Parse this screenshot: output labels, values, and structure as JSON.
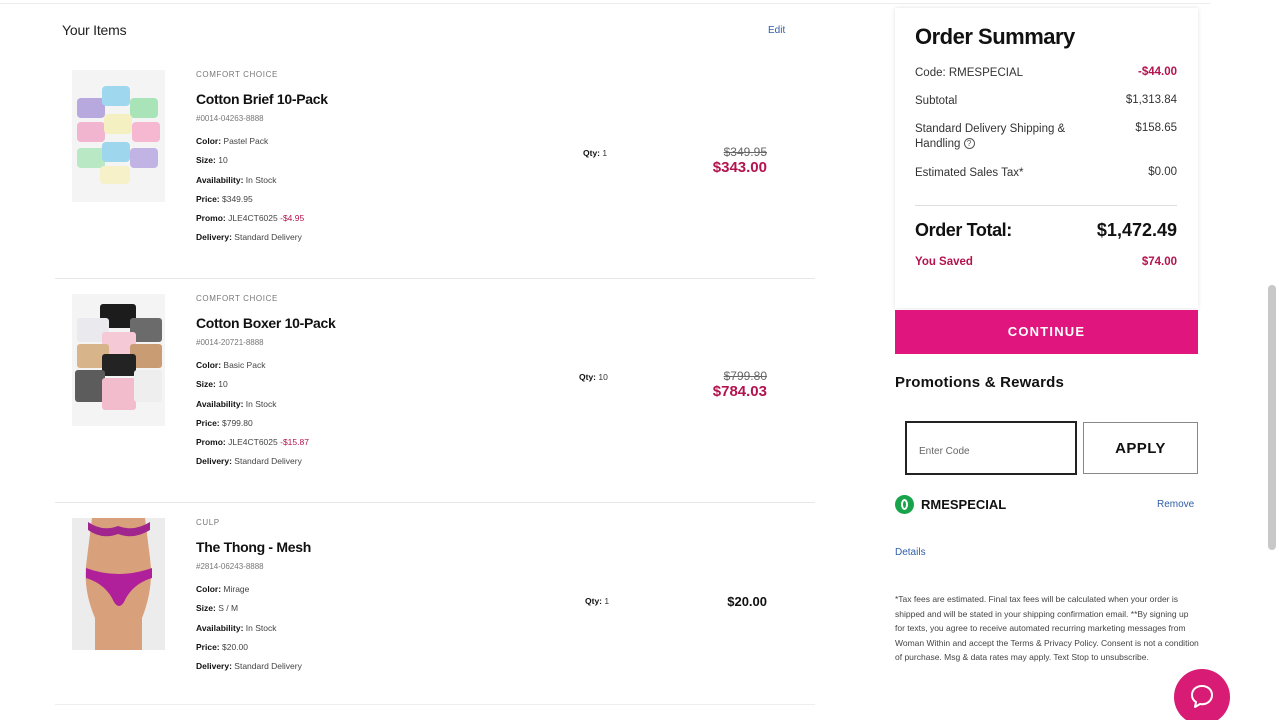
{
  "items_section": {
    "heading": "Your Items",
    "edit_label": "Edit"
  },
  "items": [
    {
      "brand": "COMFORT CHOICE",
      "name": "Cotton Brief 10-Pack",
      "sku": "#0014-04263-8888",
      "color_label": "Color:",
      "color": "Pastel Pack",
      "size_label": "Size:",
      "size": "10",
      "availability_label": "Availability:",
      "availability": "In Stock",
      "price_label": "Price:",
      "price": "$349.95",
      "promo_label": "Promo:",
      "promo_code": "JLE4CT6025",
      "promo_discount": "-$4.95",
      "delivery_label": "Delivery:",
      "delivery": "Standard Delivery",
      "qty_label": "Qty:",
      "qty": "1",
      "original_price": "$349.95",
      "final_price": "$343.00"
    },
    {
      "brand": "COMFORT CHOICE",
      "name": "Cotton Boxer 10-Pack",
      "sku": "#0014-20721-8888",
      "color_label": "Color:",
      "color": "Basic Pack",
      "size_label": "Size:",
      "size": "10",
      "availability_label": "Availability:",
      "availability": "In Stock",
      "price_label": "Price:",
      "price": "$799.80",
      "promo_label": "Promo:",
      "promo_code": "JLE4CT6025",
      "promo_discount": "-$15.87",
      "delivery_label": "Delivery:",
      "delivery": "Standard Delivery",
      "qty_label": "Qty:",
      "qty": "10",
      "original_price": "$799.80",
      "final_price": "$784.03"
    },
    {
      "brand": "CULP",
      "name": "The Thong - Mesh",
      "sku": "#2814-06243-8888",
      "color_label": "Color:",
      "color": "Mirage",
      "size_label": "Size:",
      "size": "S / M",
      "availability_label": "Availability:",
      "availability": "In Stock",
      "price_label": "Price:",
      "price": "$20.00",
      "delivery_label": "Delivery:",
      "delivery": "Standard Delivery",
      "qty_label": "Qty:",
      "qty": "1",
      "final_price": "$20.00"
    }
  ],
  "summary": {
    "title": "Order Summary",
    "code_label": "Code: RMESPECIAL",
    "code_value": "-$44.00",
    "subtotal_label": "Subtotal",
    "subtotal_value": "$1,313.84",
    "shipping_label": "Standard Delivery Shipping & Handling",
    "shipping_value": "$158.65",
    "tax_label": "Estimated Sales Tax*",
    "tax_value": "$0.00",
    "total_label": "Order Total:",
    "total_value": "$1,472.49",
    "saved_label": "You Saved",
    "saved_value": "$74.00"
  },
  "checkout": {
    "continue_label": "CONTINUE"
  },
  "promotions": {
    "heading": "Promotions & Rewards",
    "input_placeholder": "Enter Code",
    "apply_label": "APPLY",
    "applied_code": "RMESPECIAL",
    "remove_label": "Remove",
    "details_label": "Details",
    "disclaimer": "*Tax fees are estimated. Final tax fees will be calculated when your order is shipped and will be stated in your shipping confirmation email. **By signing up for texts, you agree to receive automated recurring marketing messages from Woman Within and accept the Terms & Privacy Policy. Consent is not a condition of purchase. Msg & data rates may apply. Text Stop to unsubscribe."
  },
  "colors": {
    "accent_pink": "#e0157e",
    "discount_red": "#b3134e",
    "link_blue": "#2f5ea8",
    "success_green": "#19a34a"
  },
  "icons": {
    "help": "help-circle-icon",
    "applied": "check-circle-icon",
    "chat": "chat-bubble-icon"
  }
}
